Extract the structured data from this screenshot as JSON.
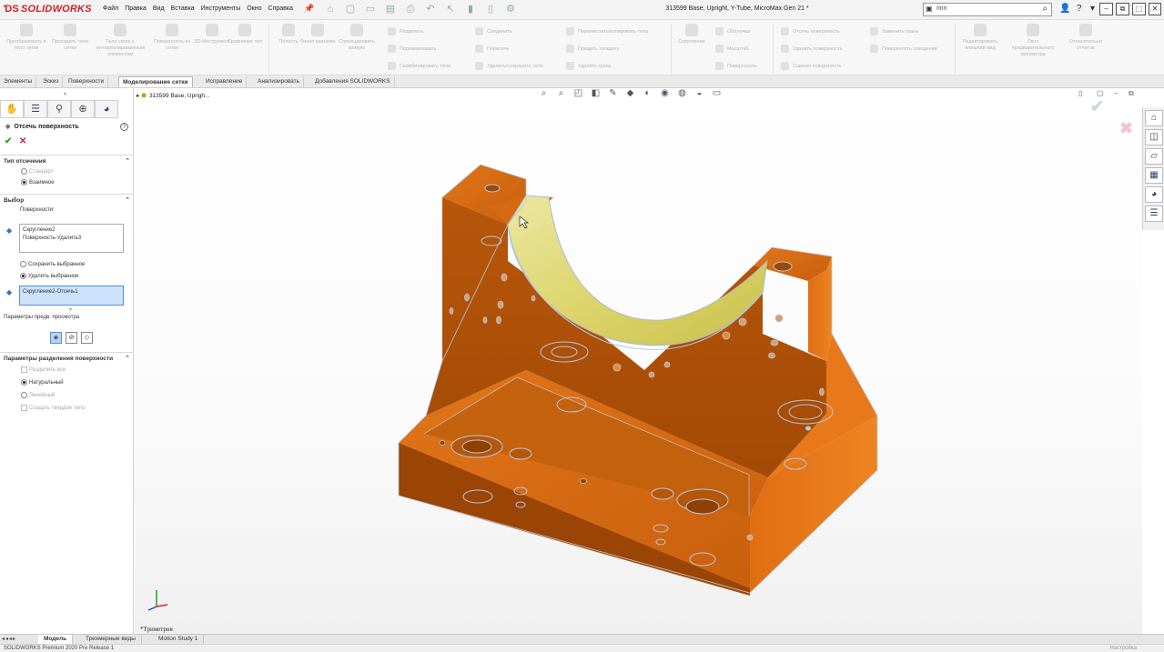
{
  "app": {
    "logo": "SOLIDWORKS",
    "menu": [
      "Файл",
      "Правка",
      "Вид",
      "Вставка",
      "Инструменты",
      "Окно",
      "Справка"
    ],
    "doc_title": "313599 Base, Upright, Y-Tube, MicroMax Gen 21 *",
    "search_value": "ппп"
  },
  "ribbon": {
    "big_buttons": [
      {
        "label": "Преобразовать в тело сетки"
      },
      {
        "label": "Проходить тело сетки"
      },
      {
        "label": "Тело сетки с интерполированным элементом"
      },
      {
        "label": "Поверхность из сетки"
      },
      {
        "label": "3D-Инструмент"
      },
      {
        "label": "Сравнение тел"
      },
      {
        "label": "Полость"
      },
      {
        "label": "Линия разъема"
      },
      {
        "label": "Спроецировать кривую"
      }
    ],
    "small_col1": [
      "Разделить",
      "Переименовать",
      "Скомбинировать тела"
    ],
    "small_col2": [
      "Соединить",
      "Пересечь",
      "Удалить/сохранить тело"
    ],
    "small_col3": [
      "Переместить/копировать тела",
      "Придать толщину",
      "Удалить грань"
    ],
    "group2_big": "Скругление",
    "small_col4": [
      "Оболочка",
      "Масштаб",
      "Поверхность"
    ],
    "small_col5": [
      "Отсечь поверхность",
      "Удалить поверхность",
      "Сшитая поверхность"
    ],
    "small_col6": [
      "Заменить грань",
      "Поверхность смещения"
    ],
    "group3_big": [
      "Редактировать внешний вид",
      "Окно предварительного просмотра",
      "Относительно отчетов"
    ]
  },
  "tabs": [
    {
      "label": "Элементы"
    },
    {
      "label": "Эскиз"
    },
    {
      "label": "Поверхности"
    },
    {
      "label": "Моделирование сетки",
      "active": true
    },
    {
      "label": "Исправление"
    },
    {
      "label": "Анализировать"
    },
    {
      "label": "Добавления SOLIDWORKS"
    }
  ],
  "property_manager": {
    "title": "Отсечь поверхность",
    "trim_type": {
      "header": "Тип отсечения",
      "options": [
        {
          "label": "Стандарт",
          "selected": false
        },
        {
          "label": "Взаимное",
          "selected": true
        }
      ]
    },
    "selection": {
      "header": "Выбор",
      "surfaces_label": "Поверхности:",
      "surfaces": [
        "Скругление2",
        "Поверхность-Удалить3"
      ],
      "keep_options": [
        {
          "label": "Сохранить выбранное",
          "selected": false
        },
        {
          "label": "Удалить выбранное",
          "selected": true
        }
      ],
      "pieces": "Скругление2-Отсечь1"
    },
    "preview_label": "Параметры предв. просмотра",
    "split_params": {
      "header": "Параметры разделения поверхности",
      "options": [
        {
          "label": "Разделить все",
          "type": "check",
          "disabled": true
        },
        {
          "label": "Натуральный",
          "type": "radio",
          "selected": true
        },
        {
          "label": "Линейный",
          "type": "radio",
          "selected": false,
          "disabled": true
        },
        {
          "label": "Создать твердое тело",
          "type": "check",
          "disabled": true
        }
      ]
    }
  },
  "viewport": {
    "tree_item": "313599 Base, Uprigh...",
    "view_name": "*Триметрия",
    "colors": {
      "part": "#d9690f",
      "part_dark": "#a64a07",
      "surface": "#e2dc7a",
      "edge": "#b6c8e0"
    }
  },
  "bottom_tabs": [
    {
      "label": "Модель",
      "active": true
    },
    {
      "label": "Трехмерные виды"
    },
    {
      "label": "Motion Study 1"
    }
  ],
  "status": {
    "left": "SOLIDWORKS Premium 2020 Pre Release 1",
    "right": "Настройка"
  }
}
